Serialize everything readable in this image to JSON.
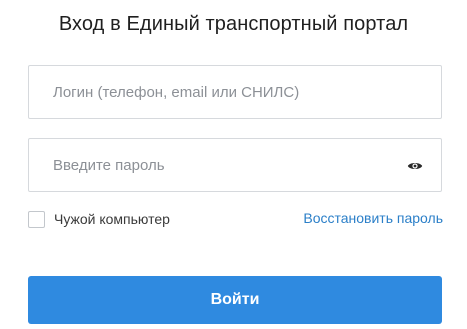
{
  "title": "Вход в Единый транспортный портал",
  "login": {
    "value": "",
    "placeholder": "Логин (телефон, email или СНИЛС)"
  },
  "password": {
    "value": "",
    "placeholder": "Введите пароль",
    "toggle_icon": "eye-icon"
  },
  "remember": {
    "label": "Чужой компьютер",
    "checked": false
  },
  "restore_link": "Восстановить пароль",
  "submit_label": "Войти",
  "colors": {
    "accent": "#2f8ae0",
    "link": "#2b7fc8",
    "border": "#d6d9dd",
    "placeholder": "#8c9096"
  }
}
